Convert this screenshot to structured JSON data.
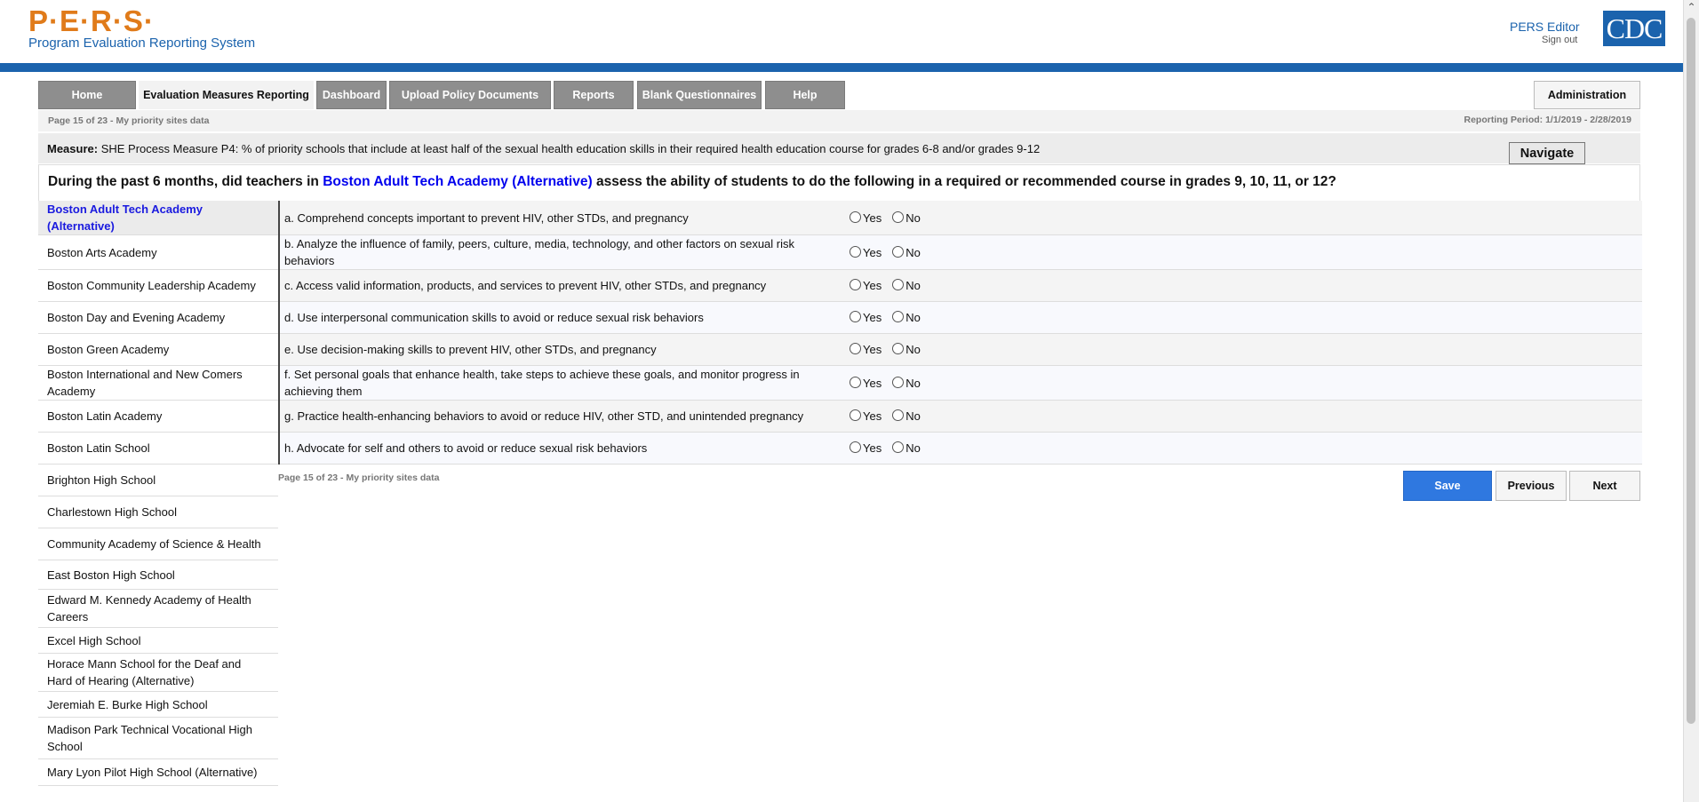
{
  "header": {
    "logo": "P·E·R·S·",
    "subtitle": "Program Evaluation Reporting System",
    "user": "PERS Editor",
    "sign_out": "Sign out",
    "agency_logo": "CDC"
  },
  "nav": {
    "tabs": [
      {
        "label": "Home",
        "active": false
      },
      {
        "label": "Evaluation Measures Reporting",
        "active": true
      },
      {
        "label": "Dashboard",
        "active": false
      },
      {
        "label": "Upload Policy Documents",
        "active": false
      },
      {
        "label": "Reports",
        "active": false
      },
      {
        "label": "Blank Questionnaires",
        "active": false
      },
      {
        "label": "Help",
        "active": false
      }
    ],
    "admin": "Administration"
  },
  "info": {
    "page_info": "Page 15 of 23 - My priority sites data",
    "reporting_period": "Reporting Period: 1/1/2019 - 2/28/2019"
  },
  "measure": {
    "label": "Measure:",
    "text": "SHE Process Measure P4: % of priority schools that include at least half of the sexual health education skills in their required health education course for grades 6-8 and/or grades 9-12",
    "navigate": "Navigate"
  },
  "question": {
    "prefix": "During the past 6 months, did teachers in",
    "site": "Boston Adult Tech Academy (Alternative)",
    "suffix": "assess the ability of students to do the following in a required or recommended course in grades 9, 10, 11, or 12?"
  },
  "schools": [
    "Boston Adult Tech Academy (Alternative)",
    "Boston Arts Academy",
    "Boston Community Leadership Academy",
    "Boston Day and Evening Academy",
    "Boston Green Academy",
    "Boston International and New Comers Academy",
    "Boston Latin Academy",
    "Boston Latin School",
    "Brighton High School",
    "Charlestown High School",
    "Community Academy of Science & Health",
    "East Boston High School",
    "Edward M. Kennedy Academy of Health Careers",
    "Excel High School",
    "Horace Mann School for the Deaf and Hard of Hearing (Alternative)",
    "Jeremiah E. Burke High School",
    "Madison Park Technical Vocational High School",
    "Mary Lyon Pilot High School (Alternative)"
  ],
  "items": [
    "a. Comprehend concepts important to prevent HIV, other STDs, and pregnancy",
    "b. Analyze the influence of family, peers, culture, media, technology, and other factors on sexual risk behaviors",
    "c. Access valid information, products, and services to prevent HIV, other STDs, and pregnancy",
    "d. Use interpersonal communication skills to avoid or reduce sexual risk behaviors",
    "e. Use decision-making skills to prevent HIV, other STDs, and pregnancy",
    "f. Set personal goals that enhance health, take steps to achieve these goals, and monitor progress in achieving them",
    "g. Practice health-enhancing behaviors to avoid or reduce HIV, other STD, and unintended pregnancy",
    "h. Advocate for self and others to avoid or reduce sexual risk behaviors"
  ],
  "options": {
    "yes": "Yes",
    "no": "No"
  },
  "footer": {
    "page_info": "Page 15 of 23 - My priority sites data",
    "save": "Save",
    "previous": "Previous",
    "next": "Next"
  }
}
